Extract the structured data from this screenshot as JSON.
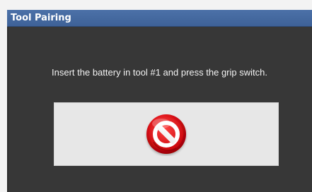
{
  "window": {
    "title": "Tool Pairing"
  },
  "main": {
    "instruction": "Insert the battery in tool #1 and press the grip switch."
  },
  "status": {
    "icon": "no-entry-icon",
    "accent_color": "#d40f14"
  }
}
